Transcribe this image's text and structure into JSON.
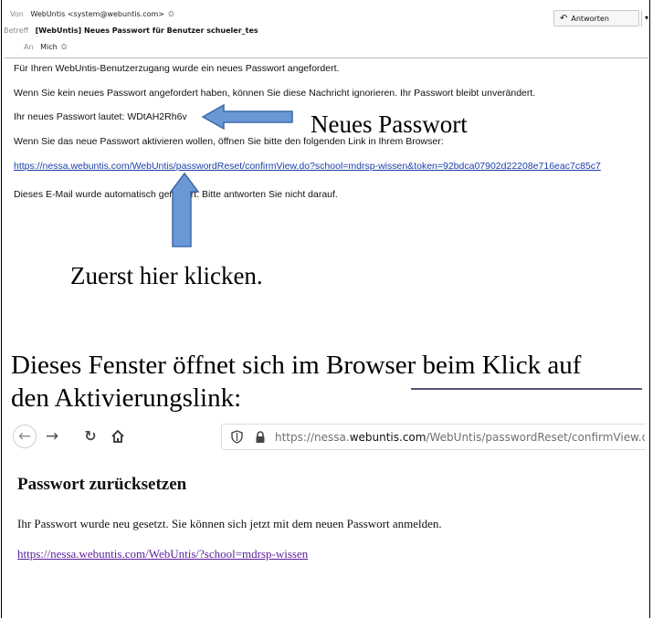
{
  "email": {
    "from_label": "Von",
    "from_value": "WebUntis <system@webuntis.com>",
    "subject_label": "Betreff",
    "subject_value": "[WebUntis] Neues Passwort für Benutzer schueler_tes",
    "to_label": "An",
    "to_value": "Mich",
    "reply_button_label": "Antworten",
    "more_button_label": "▾",
    "body": {
      "line1": "Für Ihren WebUntis-Benutzerzugang wurde ein neues Passwort angefordert.",
      "line2": "Wenn Sie kein neues Passwort angefordert haben, können Sie diese Nachricht ignorieren. Ihr Passwort bleibt unverändert.",
      "line3": "Ihr neues Passwort lautet: WDtAH2Rh6v",
      "line4": "Wenn Sie das neue Passwort aktivieren wollen, öffnen Sie bitte den folgenden Link in Ihrem Browser:",
      "link": "https://nessa.webuntis.com/WebUntis/passwordReset/confirmView.do?school=mdrsp-wissen&token=92bdca07902d22208e716eac7c85c7",
      "line5": "Dieses E-Mail wurde automatisch generiert. Bitte antworten Sie nicht darauf."
    }
  },
  "annotations": {
    "new_password": "Neues Passwort",
    "click_here": "Zuerst hier klicken.",
    "window_note_line1": "Dieses Fenster öffnet sich im Browser beim Klick auf",
    "window_note_line2": "den Aktivierungslink:"
  },
  "browser": {
    "url_prefix": "https://nessa.",
    "url_domain": "webuntis.com",
    "url_suffix": "/WebUntis/passwordReset/confirmView.do",
    "page_title": "Passwort zurücksetzen",
    "page_text": "Ihr Passwort wurde neu gesetzt. Sie können sich jetzt mit dem neuen Passwort anmelden.",
    "page_link": "https://nessa.webuntis.com/WebUntis/?school=mdrsp-wissen"
  },
  "colors": {
    "arrow_fill": "#6a98d6",
    "arrow_stroke": "#3d6aa8",
    "link": "#1a3ea8",
    "visited_link": "#5a1d9a"
  },
  "icons": [
    "star-icon",
    "reply-icon",
    "back-arrow-icon",
    "forward-arrow-icon",
    "reload-icon",
    "home-icon",
    "shield-icon",
    "lock-icon"
  ]
}
